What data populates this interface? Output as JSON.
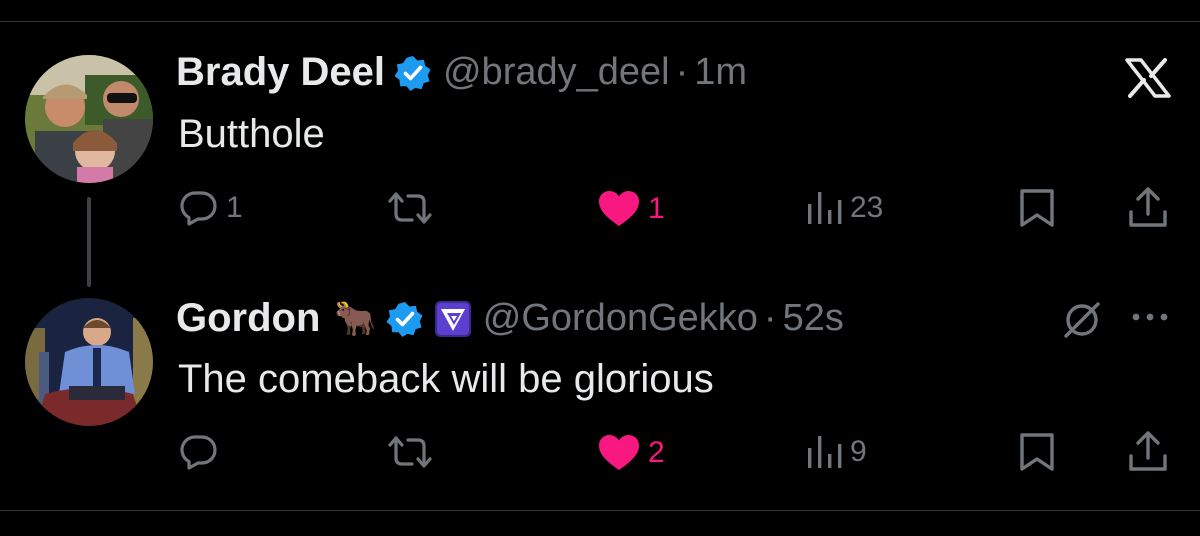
{
  "tweets": [
    {
      "display_name": "Brady Deel",
      "handle": "@brady_deel",
      "separator": "·",
      "time": "1m",
      "text": "Butthole",
      "replies": "1",
      "reposts": "",
      "likes": "1",
      "views": "23",
      "liked": true
    },
    {
      "display_name": "Gordon",
      "name_emoji": "🐂",
      "handle": "@GordonGekko",
      "separator": "·",
      "time": "52s",
      "text": "The comeback will be glorious",
      "replies": "",
      "reposts": "",
      "likes": "2",
      "views": "9",
      "liked": true
    }
  ],
  "colors": {
    "background": "#000000",
    "text": "#e7e9ea",
    "muted": "#71767b",
    "like": "#f91880",
    "verified": "#1d9bf0"
  },
  "icons": [
    "x-logo-icon",
    "reply-icon",
    "repost-icon",
    "heart-icon",
    "views-icon",
    "bookmark-icon",
    "share-icon",
    "verified-icon",
    "grok-icon",
    "more-icon",
    "affiliate-badge-icon"
  ]
}
